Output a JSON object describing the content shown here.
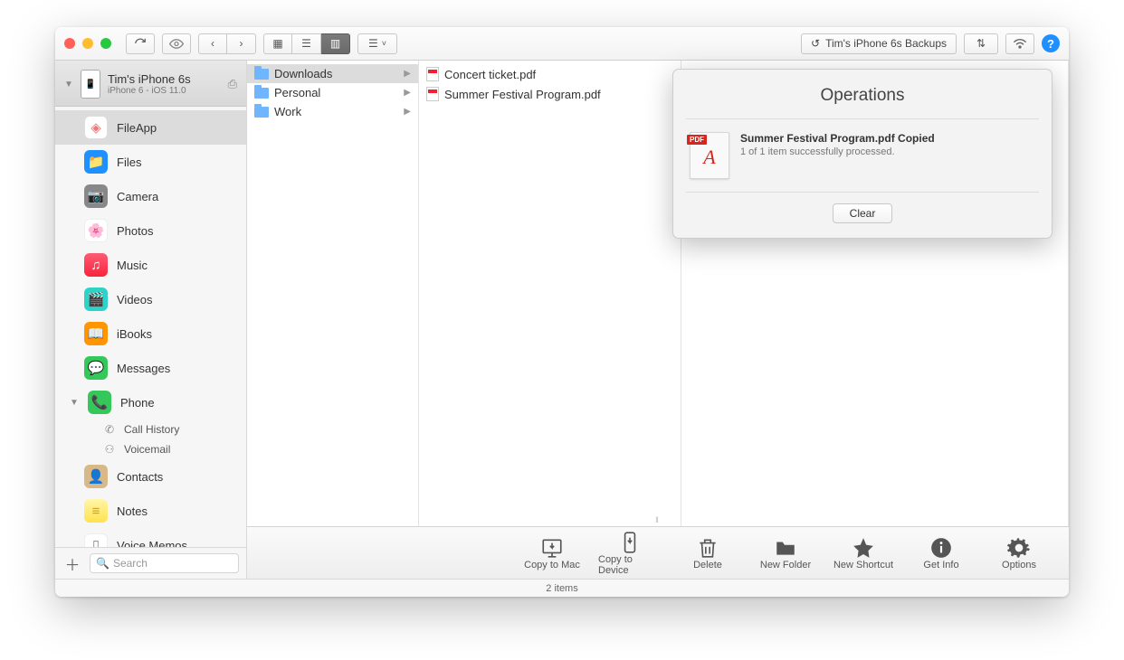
{
  "toolbar": {
    "backups_label": "Tim's iPhone 6s Backups"
  },
  "device": {
    "name": "Tim's iPhone 6s",
    "subtitle": "iPhone 6 - iOS 11.0"
  },
  "sidebar": {
    "items": [
      {
        "label": "FileApp"
      },
      {
        "label": "Files"
      },
      {
        "label": "Camera"
      },
      {
        "label": "Photos"
      },
      {
        "label": "Music"
      },
      {
        "label": "Videos"
      },
      {
        "label": "iBooks"
      },
      {
        "label": "Messages"
      },
      {
        "label": "Phone"
      },
      {
        "label": "Contacts"
      },
      {
        "label": "Notes"
      },
      {
        "label": "Voice Memos"
      }
    ],
    "phone_sub": [
      {
        "label": "Call History"
      },
      {
        "label": "Voicemail"
      }
    ],
    "search_placeholder": "Search"
  },
  "columns": {
    "col1": [
      {
        "label": "Downloads",
        "selected": true
      },
      {
        "label": "Personal"
      },
      {
        "label": "Work"
      }
    ],
    "col2": [
      {
        "label": "Concert ticket.pdf"
      },
      {
        "label": "Summer Festival Program.pdf"
      }
    ]
  },
  "bottom": {
    "copy_mac": "Copy to Mac",
    "copy_device": "Copy to Device",
    "delete": "Delete",
    "new_folder": "New Folder",
    "new_shortcut": "New Shortcut",
    "get_info": "Get Info",
    "options": "Options"
  },
  "status": "2 items",
  "popover": {
    "title": "Operations",
    "item_title": "Summer Festival Program.pdf Copied",
    "item_sub": "1 of 1 item successfully processed.",
    "clear": "Clear",
    "pdf_badge": "PDF"
  }
}
